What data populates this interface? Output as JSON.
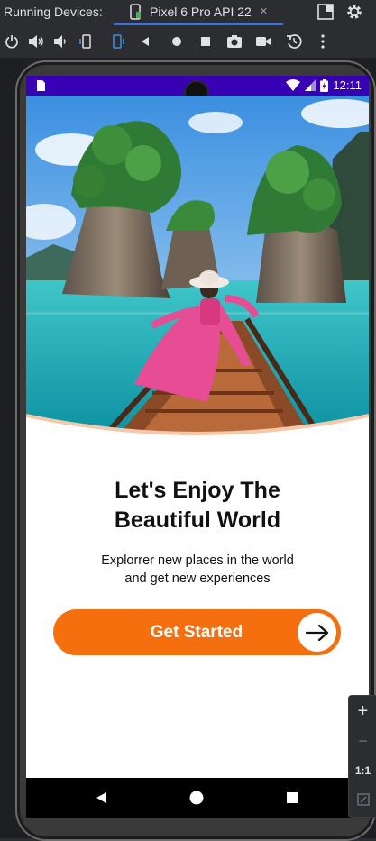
{
  "ide": {
    "title": "Running Devices:",
    "device_tab": "Pixel 6 Pro API 22",
    "tab_close": "×",
    "toolbar_icons": [
      "power-icon",
      "volume-up-icon",
      "volume-down-icon",
      "rotate-left-icon",
      "rotate-right-icon",
      "back-icon",
      "home-icon",
      "overview-icon",
      "screenshot-icon",
      "screen-record-icon",
      "reset-icon",
      "more-icon"
    ],
    "zoom": {
      "in": "+",
      "out": "−",
      "actual": "1:1"
    }
  },
  "status_bar": {
    "time": "12:11"
  },
  "onboarding": {
    "title_line1": "Let's Enjoy The",
    "title_line2": "Beautiful World",
    "subtitle_line1": "Explorrer new places in the world",
    "subtitle_line2": "and get new experiences",
    "cta_label": "Get Started"
  },
  "colors": {
    "accent": "#f66f0f",
    "status_bar": "#3700b3",
    "ide_bg": "#2b2d30"
  }
}
